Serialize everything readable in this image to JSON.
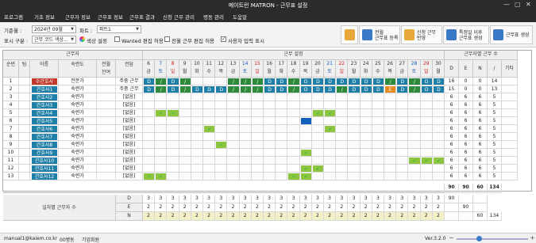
{
  "window": {
    "title": "메이트런 MATRON - 근무표 설정",
    "minimize": "—",
    "maximize": "▢",
    "close": "✕"
  },
  "menu": [
    "프로그램",
    "기초 정보",
    "근무자 정보",
    "근무표 정보",
    "근무표 결과",
    "신청 근무 관리",
    "병동 관리",
    "도움말"
  ],
  "toolbar": {
    "month_label": "기준월 :",
    "month_value": "2024년 09월",
    "part_label": "파트 :",
    "part_value": "파트1",
    "display_label": "표시 구분 :",
    "display_value": "근무 코드 색상...",
    "color_button": "색상 설정",
    "wanted_label": "Wanted 편집 허용",
    "full_edit_label": "전월 근무 편집 허용",
    "user_input_label": "사용자 입력 표시",
    "buttons": [
      {
        "label": "",
        "color": "#e8a83a"
      },
      {
        "label": "전월\n근무표 등록",
        "color": "#3a78c8"
      },
      {
        "label": "신청 근무\n반영",
        "color": "#e8a83a"
      },
      {
        "label": "특정일 이후\n근무표 생성",
        "color": "#3a78c8"
      },
      {
        "label": "근무표 생성",
        "color": "#3a78c8"
      }
    ]
  },
  "grid": {
    "header_worker": "근무자",
    "header_settings": "근무 설정",
    "header_counts": "근무자별 근무 수",
    "col_headers": [
      "순번",
      "팀",
      "이름",
      "숙련도",
      "전월\n잔여",
      "전담"
    ],
    "days": [
      {
        "d": "6",
        "w": "금"
      },
      {
        "d": "7",
        "w": "토"
      },
      {
        "d": "8",
        "w": "일"
      },
      {
        "d": "9",
        "w": "월"
      },
      {
        "d": "10",
        "w": "화"
      },
      {
        "d": "11",
        "w": "수"
      },
      {
        "d": "12",
        "w": "목"
      },
      {
        "d": "13",
        "w": "금"
      },
      {
        "d": "14",
        "w": "토"
      },
      {
        "d": "15",
        "w": "일"
      },
      {
        "d": "16",
        "w": "월"
      },
      {
        "d": "17",
        "w": "화"
      },
      {
        "d": "18",
        "w": "수"
      },
      {
        "d": "19",
        "w": "목"
      },
      {
        "d": "20",
        "w": "금"
      },
      {
        "d": "21",
        "w": "토"
      },
      {
        "d": "22",
        "w": "일"
      },
      {
        "d": "23",
        "w": "월"
      },
      {
        "d": "24",
        "w": "화"
      },
      {
        "d": "25",
        "w": "수"
      },
      {
        "d": "26",
        "w": "목"
      },
      {
        "d": "27",
        "w": "금"
      },
      {
        "d": "28",
        "w": "토"
      },
      {
        "d": "29",
        "w": "일"
      },
      {
        "d": "30",
        "w": "월"
      }
    ],
    "count_headers": [
      "D",
      "E",
      "N",
      "/",
      "기타"
    ],
    "rows": [
      {
        "no": "1",
        "name": "수간호사",
        "skill": "전문가",
        "rest": "",
        "duty": "주중 근무",
        "name_bg": "#c0392b",
        "counts": [
          "16",
          "0",
          "0",
          "14",
          ""
        ]
      },
      {
        "no": "2",
        "name": "간호사1",
        "skill": "숙련가",
        "rest": "",
        "duty": "주중 근무",
        "name_bg": "#1f7fa6",
        "counts": [
          "15",
          "0",
          "0",
          "13",
          ""
        ]
      },
      {
        "no": "3",
        "name": "간호사2",
        "skill": "숙련가",
        "rest": "",
        "duty": "[없음]",
        "name_bg": "#1f7fa6",
        "counts": [
          "6",
          "6",
          "6",
          "5",
          ""
        ]
      },
      {
        "no": "4",
        "name": "간호사3",
        "skill": "숙련가",
        "rest": "",
        "duty": "[없음]",
        "name_bg": "#1f7fa6",
        "counts": [
          "6",
          "6",
          "6",
          "5",
          ""
        ]
      },
      {
        "no": "5",
        "name": "간호사4",
        "skill": "숙련가",
        "rest": "",
        "duty": "[없음]",
        "name_bg": "#1f7fa6",
        "counts": [
          "6",
          "6",
          "6",
          "5",
          ""
        ]
      },
      {
        "no": "6",
        "name": "간호사5",
        "skill": "숙련가",
        "rest": "",
        "duty": "[없음]",
        "name_bg": "#1f7fa6",
        "counts": [
          "6",
          "6",
          "6",
          "5",
          ""
        ]
      },
      {
        "no": "7",
        "name": "간호사6",
        "skill": "숙련가",
        "rest": "",
        "duty": "[없음]",
        "name_bg": "#1f7fa6",
        "counts": [
          "6",
          "6",
          "6",
          "5",
          ""
        ]
      },
      {
        "no": "8",
        "name": "간호사7",
        "skill": "숙련가",
        "rest": "",
        "duty": "[없음]",
        "name_bg": "#1f7fa6",
        "counts": [
          "6",
          "6",
          "6",
          "5",
          ""
        ]
      },
      {
        "no": "9",
        "name": "간호사8",
        "skill": "숙련가",
        "rest": "",
        "duty": "[없음]",
        "name_bg": "#1f7fa6",
        "counts": [
          "6",
          "6",
          "6",
          "5",
          ""
        ]
      },
      {
        "no": "10",
        "name": "간호사9",
        "skill": "숙련가",
        "rest": "",
        "duty": "[없음]",
        "name_bg": "#1f7fa6",
        "counts": [
          "6",
          "6",
          "6",
          "5",
          ""
        ]
      },
      {
        "no": "11",
        "name": "간호사10",
        "skill": "숙련가",
        "rest": "",
        "duty": "[없음]",
        "name_bg": "#1f7fa6",
        "counts": [
          "6",
          "6",
          "6",
          "5",
          ""
        ]
      },
      {
        "no": "12",
        "name": "간호사11",
        "skill": "숙련가",
        "rest": "",
        "duty": "[없음]",
        "name_bg": "#1f7fa6",
        "counts": [
          "6",
          "6",
          "6",
          "5",
          ""
        ]
      },
      {
        "no": "13",
        "name": "간호사12",
        "skill": "숙련가",
        "rest": "",
        "duty": "[없음]",
        "name_bg": "#1f7fa6",
        "counts": [
          "6",
          "6",
          "6",
          "5",
          ""
        ]
      }
    ],
    "row1_marks": [
      "D",
      "/",
      "D",
      "/",
      "",
      "",
      "",
      "/",
      "/",
      "/",
      "D",
      "D",
      "/",
      "D",
      "D",
      "D",
      "D",
      "D",
      "D",
      "D",
      "/",
      "D",
      "/",
      "D",
      "D"
    ],
    "row2_marks": [
      "D",
      "/",
      "D",
      "/",
      "D",
      "D",
      "D",
      "/",
      "/",
      "/",
      "D",
      "D",
      "/",
      "D",
      "D",
      "D",
      "/",
      "D",
      "D",
      "D",
      "E",
      "D",
      "/",
      "D",
      "D"
    ],
    "sparse_marks": [
      [
        1,
        4,
        "ok"
      ],
      [
        2,
        4,
        "ok"
      ],
      [
        14,
        4,
        "ok"
      ],
      [
        15,
        4,
        "ok"
      ],
      [
        13,
        5,
        "blue"
      ],
      [
        5,
        6,
        "ok"
      ],
      [
        15,
        6,
        "ok"
      ],
      [
        6,
        8,
        "ok"
      ],
      [
        13,
        9,
        "ok"
      ],
      [
        22,
        10,
        "ok"
      ],
      [
        23,
        10,
        "ok"
      ],
      [
        24,
        10,
        "ok"
      ],
      [
        13,
        11,
        "ok"
      ],
      [
        14,
        11,
        "ok"
      ],
      [
        0,
        12,
        "ok"
      ],
      [
        1,
        12,
        "ok"
      ],
      [
        12,
        12,
        "ok"
      ],
      [
        13,
        12,
        "ok"
      ]
    ],
    "totals": [
      "90",
      "90",
      "60",
      "134"
    ],
    "daily_label": "일자별 근무자 수",
    "daily": {
      "D": [
        "3",
        "3",
        "3",
        "3",
        "3",
        "3",
        "3",
        "3",
        "3",
        "3",
        "3",
        "3",
        "3",
        "3",
        "3",
        "3",
        "3",
        "3",
        "3",
        "3",
        "3",
        "3",
        "3",
        "3",
        "3"
      ],
      "E": [
        "2",
        "2",
        "2",
        "2",
        "2",
        "2",
        "2",
        "2",
        "2",
        "2",
        "2",
        "2",
        "2",
        "2",
        "2",
        "2",
        "2",
        "2",
        "2",
        "2",
        "2",
        "2",
        "2",
        "2",
        "2"
      ],
      "N": [
        "2",
        "2",
        "2",
        "2",
        "2",
        "2",
        "2",
        "2",
        "2",
        "2",
        "2",
        "2",
        "2",
        "2",
        "2",
        "2",
        "2",
        "2",
        "2",
        "2",
        "2",
        "2",
        "2",
        "2",
        "2"
      ]
    },
    "daily_counts": {
      "D": [
        "90",
        "",
        ""
      ],
      "E": [
        "",
        "90",
        ""
      ],
      "N": [
        "",
        "",
        "60",
        "134"
      ]
    },
    "colors": {
      "D": "#1f7fa6",
      "slash": "#2e8b3e",
      "E": "#e68a1f",
      "blue": "#1560bd",
      "ok": "#8cc63f",
      "sat": "#1a5fb4",
      "sun": "#d02020"
    }
  },
  "status": {
    "email": "manual1@kaiem.co.kr",
    "ward": "00병동",
    "company": "기업회원",
    "version": "Ver.3.2.0"
  }
}
